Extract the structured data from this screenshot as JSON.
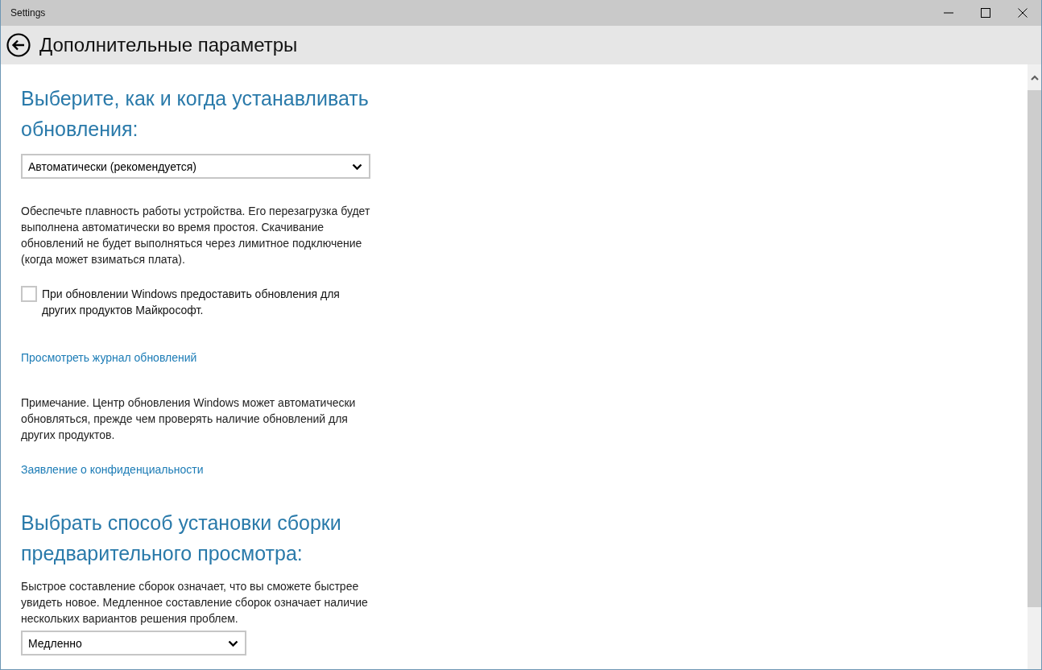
{
  "window": {
    "title": "Settings"
  },
  "header": {
    "title": "Дополнительные параметры"
  },
  "content": [
    {
      "kind": "heading",
      "text": "Выберите, как и когда устанавливать обновления:"
    },
    {
      "kind": "dropdown",
      "value": "Автоматически (рекомендуется)",
      "wide": true
    },
    {
      "kind": "paragraph",
      "text": "Обеспечьте плавность работы устройства. Его перезагрузка будет выполнена автоматически во время простоя. Скачивание обновлений не будет выполняться через лимитное подключение (когда может взиматься плата)."
    },
    {
      "kind": "checkbox",
      "label": "При обновлении Windows предоставить обновления для других продуктов Майкрософт.",
      "checked": false
    },
    {
      "kind": "link",
      "text": "Просмотреть журнал обновлений"
    },
    {
      "kind": "paragraph",
      "text": "Примечание. Центр обновления Windows может автоматически обновляться, прежде чем проверять наличие обновлений для других продуктов."
    },
    {
      "kind": "link",
      "text": "Заявление о конфиденциальности"
    },
    {
      "kind": "heading",
      "text": "Выбрать способ установки сборки предварительного просмотра:"
    },
    {
      "kind": "paragraph",
      "text": "Быстрое составление сборок означает, что вы сможете быстрее увидеть новое. Медленное составление сборок означает наличие нескольких вариантов решения проблем."
    },
    {
      "kind": "dropdown",
      "value": "Медленно",
      "wide": false
    }
  ]
}
